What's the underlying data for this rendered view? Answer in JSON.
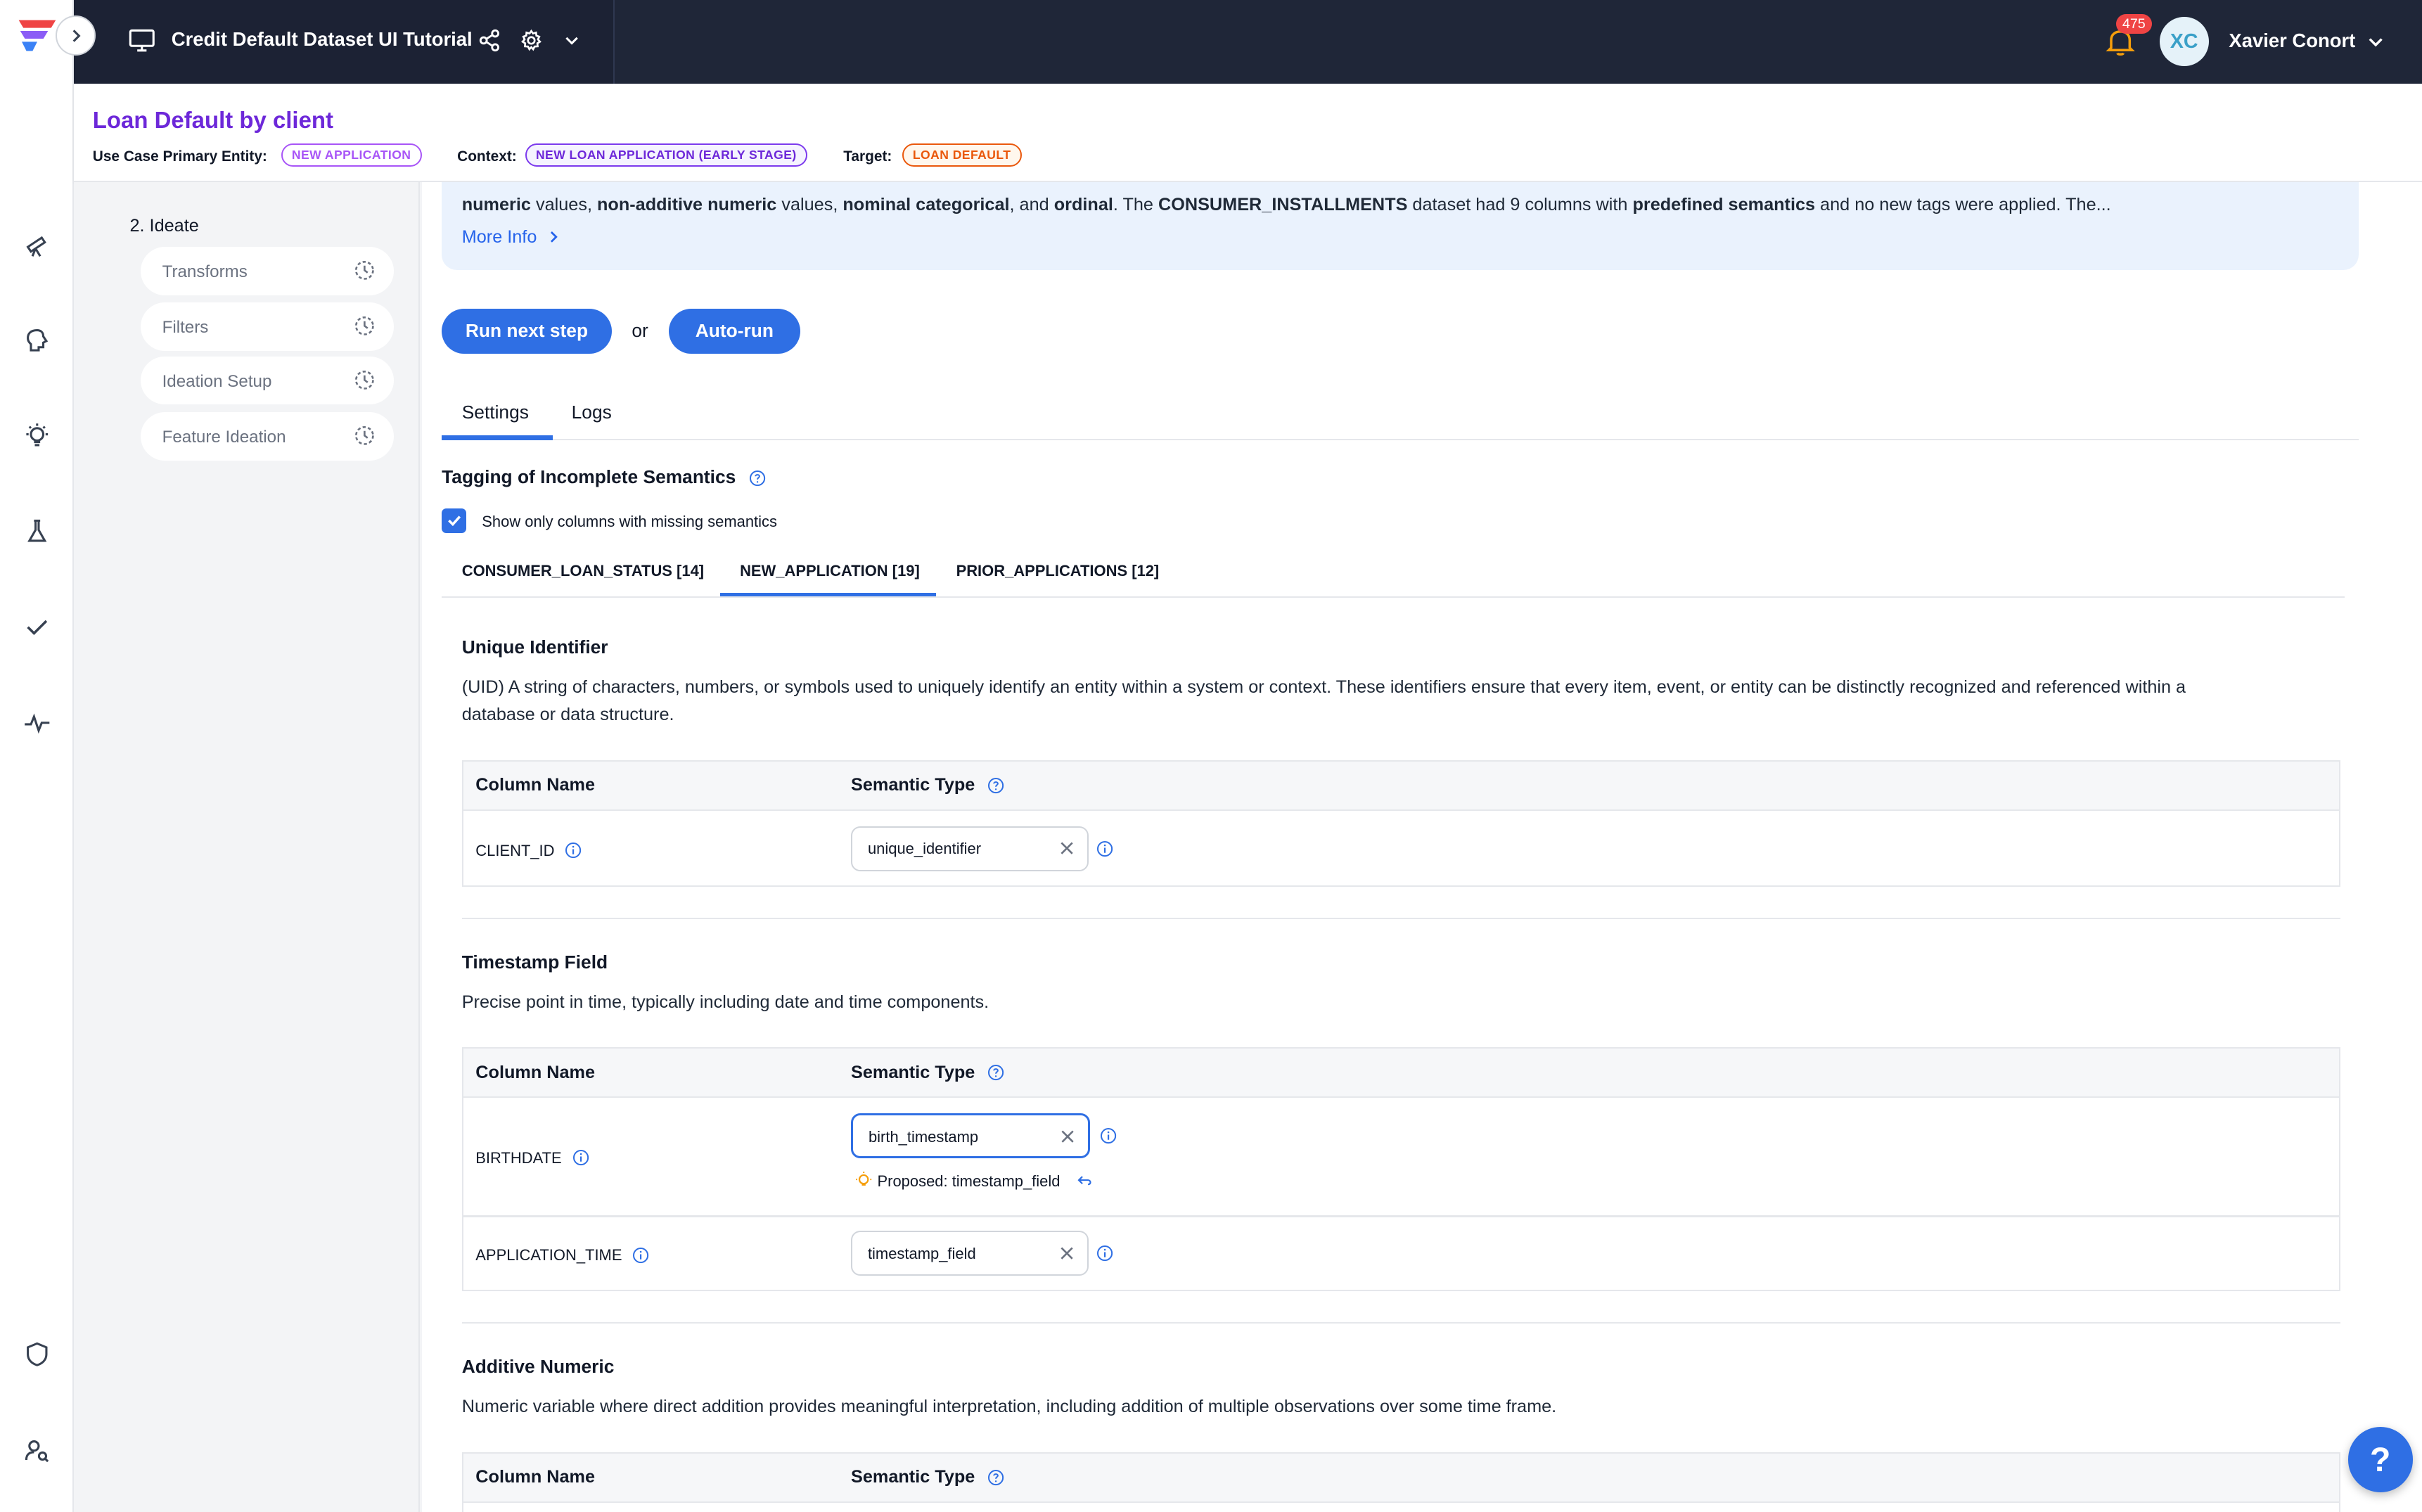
{
  "topbar": {
    "title": "Credit Default Dataset UI Tutorial",
    "notifications": "475",
    "avatar_initials": "XC",
    "user_name": "Xavier Conort"
  },
  "header": {
    "title": "Loan Default by client",
    "entity_label": "Use Case Primary Entity:",
    "entity_value": "NEW APPLICATION",
    "context_label": "Context:",
    "context_value": "NEW LOAN APPLICATION (EARLY STAGE)",
    "target_label": "Target:",
    "target_value": "LOAN DEFAULT"
  },
  "steps": {
    "section": "2. Ideate",
    "items": [
      {
        "label": "Transforms"
      },
      {
        "label": "Filters"
      },
      {
        "label": "Ideation Setup"
      },
      {
        "label": "Feature Ideation"
      }
    ]
  },
  "info": {
    "t1": "numeric",
    "t2": " values, ",
    "t3": "non-additive numeric",
    "t4": " values, ",
    "t5": "nominal categorical",
    "t6": ", and ",
    "t7": "ordinal",
    "t8": ". The ",
    "t9": "CONSUMER_INSTALLMENTS",
    "t10": " dataset had 9 columns with ",
    "t11": "predefined semantics",
    "t12": " and no new tags were applied. The...",
    "more": "More Info"
  },
  "actions": {
    "run_next": "Run next step",
    "or": "or",
    "auto_run": "Auto-run"
  },
  "tabs": [
    {
      "label": "Settings"
    },
    {
      "label": "Logs"
    }
  ],
  "tagging": {
    "title": "Tagging of Incomplete Semantics",
    "checkbox_label": "Show only columns with missing semantics"
  },
  "dataset_tabs": [
    {
      "label": "CONSUMER_LOAN_STATUS [14]"
    },
    {
      "label": "NEW_APPLICATION [19]"
    },
    {
      "label": "PRIOR_APPLICATIONS [12]"
    }
  ],
  "columns_header": {
    "name": "Column Name",
    "type": "Semantic Type"
  },
  "sections": [
    {
      "title": "Unique Identifier",
      "desc_line1": "(UID) A string of characters, numbers, or symbols used to uniquely identify an entity within a system or context. These identifiers ensure that every item, event, or entity can be distinctly recognized and referenced within a",
      "desc_line2": "database or data structure.",
      "rows": [
        {
          "column": "CLIENT_ID",
          "semantic": "unique_identifier"
        }
      ]
    },
    {
      "title": "Timestamp Field",
      "desc_line1": "Precise point in time, typically including date and time components.",
      "rows": [
        {
          "column": "BIRTHDATE",
          "semantic": "birth_timestamp",
          "proposed": "Proposed: timestamp_field"
        },
        {
          "column": "APPLICATION_TIME",
          "semantic": "timestamp_field"
        }
      ]
    },
    {
      "title": "Additive Numeric",
      "desc_line1": "Numeric variable where direct addition provides meaningful interpretation, including addition of multiple observations over some time frame."
    }
  ],
  "help": "?",
  "colors": {
    "topbar": "#1f2638",
    "accent": "#2f6fe4",
    "title_purple": "#6d28d9",
    "info_bg": "#eaf2fd"
  }
}
